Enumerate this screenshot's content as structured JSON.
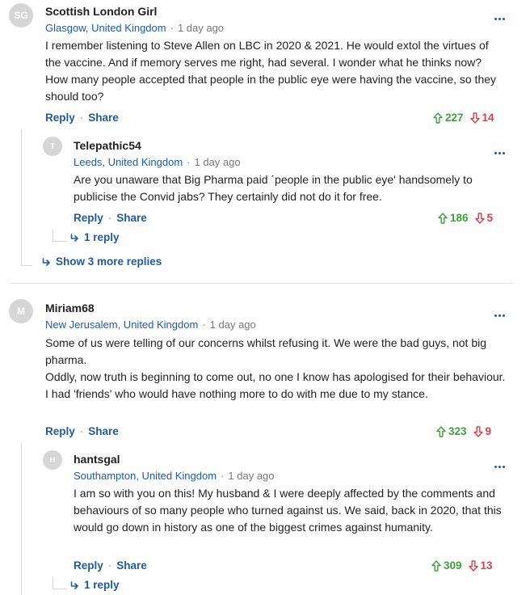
{
  "threads": [
    {
      "comment": {
        "avatar": "SG",
        "name": "Scottish London Girl",
        "location": "Glasgow, United Kingdom",
        "time": "1 day ago",
        "paragraphs": [
          "I remember listening to Steve Allen on LBC in 2020 & 2021. He would extol the virtues of the vaccine. And if memory serves me right, had several. I wonder what he thinks now? How many people accepted that people in the public eye were having the vaccine, so they should too?"
        ],
        "reply_label": "Reply",
        "share_label": "Share",
        "upvotes": "227",
        "downvotes": "14"
      },
      "reply": {
        "avatar": "T",
        "name": "Telepathic54",
        "location": "Leeds, United Kingdom",
        "time": "1 day ago",
        "paragraphs": [
          "Are you unaware that Big Pharma paid ´people in the public eye' handsomely to publicise the Convid jabs?  They certainly did not do it for free."
        ],
        "reply_label": "Reply",
        "share_label": "Share",
        "upvotes": "186",
        "downvotes": "5",
        "replies_link": "1 reply"
      },
      "more_replies": "Show 3 more replies"
    },
    {
      "comment": {
        "avatar": "M",
        "name": "Miriam68",
        "location": "New Jerusalem, United Kingdom",
        "time": "1 day ago",
        "paragraphs": [
          "Some of us were telling of our concerns whilst refusing it. We were the bad guys, not big pharma.",
          "Oddly, now truth is beginning to come out, no one I know has apologised for their behaviour.  I had 'friends' who would have nothing more to do with me due to my stance."
        ],
        "reply_label": "Reply",
        "share_label": "Share",
        "upvotes": "323",
        "downvotes": "9"
      },
      "reply": {
        "avatar": "H",
        "name": "hantsgal",
        "location": "Southampton, United Kingdom",
        "time": "1 day ago",
        "paragraphs": [
          "I am so with you on this!  My husband & I were deeply affected by the comments and behaviours of so many people who turned against us. We said, back in 2020, that this would go down in history as one of the biggest crimes against humanity."
        ],
        "reply_label": "Reply",
        "share_label": "Share",
        "upvotes": "309",
        "downvotes": "13",
        "replies_link": "1 reply"
      }
    }
  ],
  "icons": {
    "more": "more-options-icon",
    "upvote": "arrow-up-icon",
    "downvote": "arrow-down-icon",
    "reply_arrow": "reply-arrow-icon"
  },
  "colors": {
    "link": "#1f5aa6",
    "upvote": "#3aa537",
    "downvote": "#d8404a",
    "avatar": "#d6d6d6"
  }
}
